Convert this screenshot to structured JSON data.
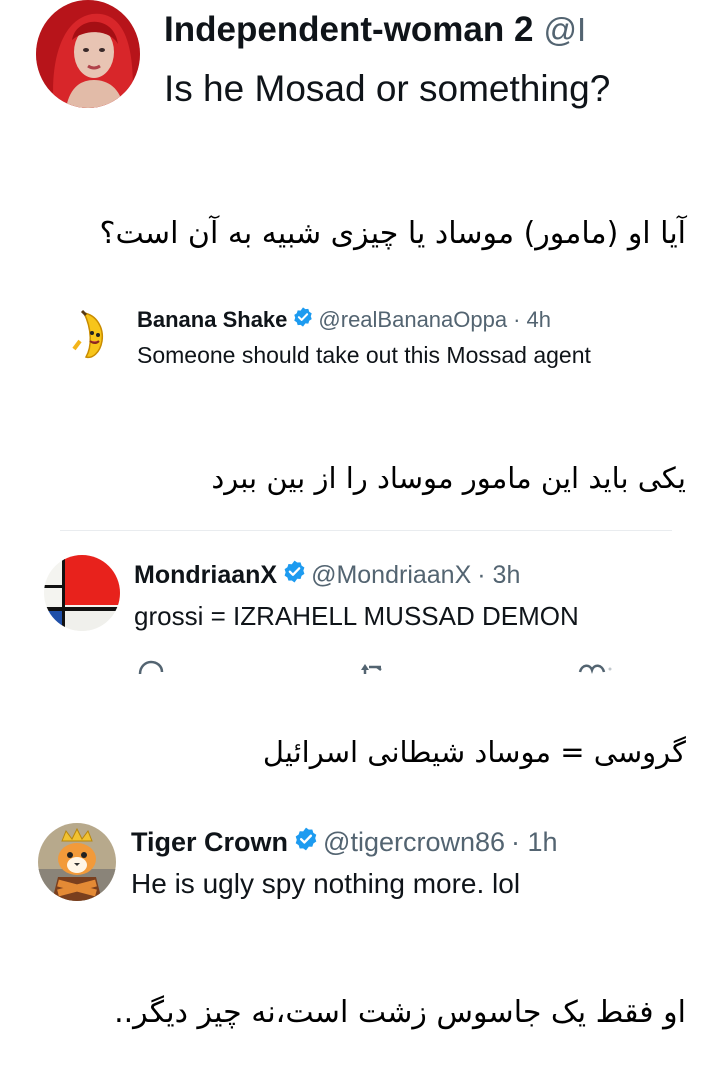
{
  "tweet1": {
    "display_name": "Independent-woman 2",
    "handle": "@I",
    "text": "Is he Mosad or something?",
    "avatar_icon": "woman-portrait-avatar"
  },
  "translation1": "آیا او (مامور) موساد یا چیزی شبیه به آن است؟",
  "tweet2": {
    "display_name": "Banana Shake",
    "handle": "@realBananaOppa",
    "time": "· 4h",
    "text": "Someone should take out this Mossad agent",
    "avatar_icon": "banana-avatar"
  },
  "translation2": "یکی باید این مامور موساد را از بین ببرد",
  "tweet3": {
    "display_name": "MondriaanX",
    "handle": "@MondriaanX",
    "time": "· 3h",
    "text": "grossi = IZRAHELL MUSSAD DEMON",
    "avatar_icon": "mondrian-avatar"
  },
  "translation3": "گروسی = موساد شیطانی اسرائیل",
  "tweet4": {
    "display_name": "Tiger Crown",
    "handle": "@tigercrown86",
    "time": "· 1h",
    "text": "He is ugly spy nothing more. lol",
    "avatar_icon": "tiger-crown-avatar"
  },
  "translation4": "او فقط یک جاسوس زشت است،نه چیز دیگر..",
  "colors": {
    "verified_blue": "#1d9bf0",
    "handle_gray": "#536471",
    "text_black": "#0f1419"
  }
}
